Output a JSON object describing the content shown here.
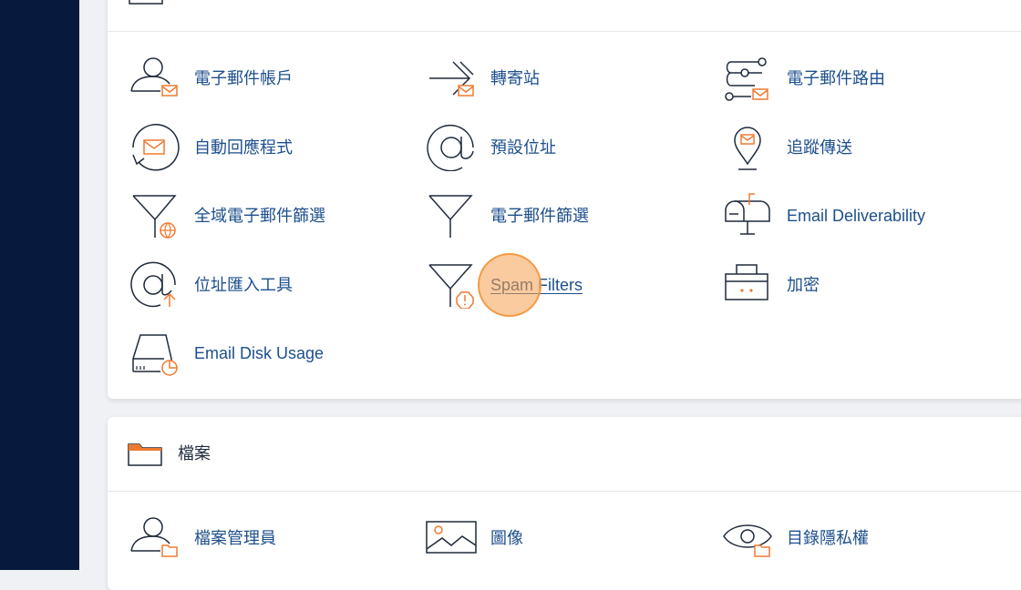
{
  "sidebar": {
    "label": ""
  },
  "email_section": {
    "items": [
      {
        "label": "電子郵件帳戶",
        "icon": "user-mail-icon"
      },
      {
        "label": "轉寄站",
        "icon": "forward-arrow-icon"
      },
      {
        "label": "電子郵件路由",
        "icon": "routing-icon"
      },
      {
        "label": "自動回應程式",
        "icon": "autoresponder-icon"
      },
      {
        "label": "預設位址",
        "icon": "at-sign-icon"
      },
      {
        "label": "追蹤傳送",
        "icon": "location-pin-icon"
      },
      {
        "label": "全域電子郵件篩選",
        "icon": "global-filter-icon"
      },
      {
        "label": "電子郵件篩選",
        "icon": "filter-icon"
      },
      {
        "label": "Email Deliverability",
        "icon": "mailbox-icon"
      },
      {
        "label": "位址匯入工具",
        "icon": "at-import-icon"
      },
      {
        "label": "Spam Filters",
        "icon": "spam-filter-icon"
      },
      {
        "label": "加密",
        "icon": "briefcase-icon"
      },
      {
        "label": "Email Disk Usage",
        "icon": "disk-usage-icon"
      }
    ]
  },
  "files_section": {
    "title": "檔案",
    "items": [
      {
        "label": "檔案管理員",
        "icon": "user-folder-icon"
      },
      {
        "label": "圖像",
        "icon": "image-icon"
      },
      {
        "label": "目錄隱私權",
        "icon": "eye-folder-icon"
      }
    ]
  },
  "colors": {
    "accent": "#f07a30",
    "link": "#1d4f8c",
    "sidebar": "#071a3d"
  }
}
